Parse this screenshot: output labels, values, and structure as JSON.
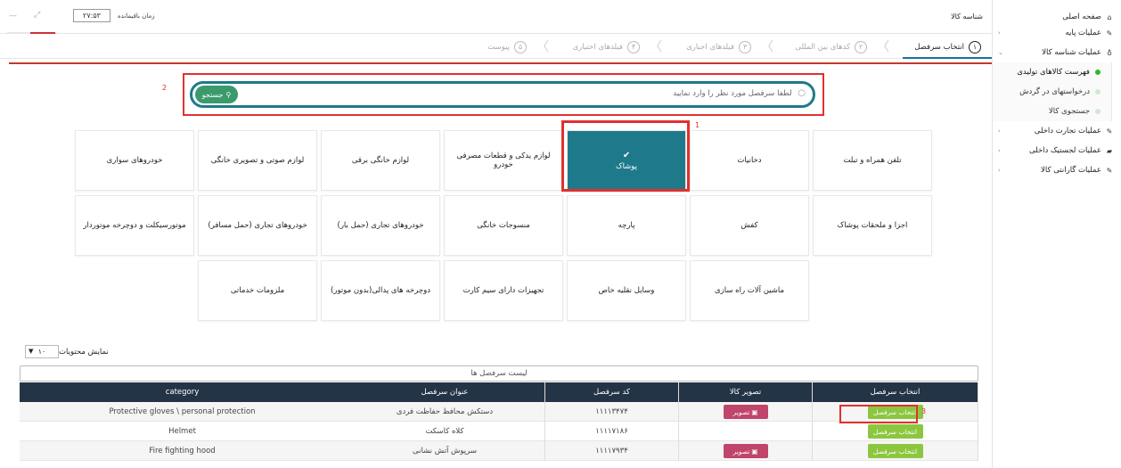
{
  "sidebar": {
    "home": "صفحه اصلی",
    "items": [
      {
        "label": "عملیات پایه",
        "icon": "edit-icon"
      },
      {
        "label": "عملیات شناسه کالا",
        "icon": "bicycle-icon"
      }
    ],
    "subitems": [
      {
        "label": "فهرست کالاهای تولیدی",
        "active": true
      },
      {
        "label": "درخواستهای در گردش",
        "active": false
      },
      {
        "label": "جستجوی کالا",
        "active": false
      }
    ],
    "items2": [
      {
        "label": "عملیات تجارت داخلی",
        "icon": "edit-icon"
      },
      {
        "label": "عملیات لجستیک داخلی",
        "icon": "truck-icon"
      },
      {
        "label": "عملیات گارانتی کالا",
        "icon": "edit-icon"
      }
    ]
  },
  "topbar": {
    "title": "شناسه کالا",
    "time_label": "زمان باقیمانده",
    "time_value": "۲۷:۵۳"
  },
  "steps": [
    {
      "num": "۱",
      "label": "انتخاب سرفصل"
    },
    {
      "num": "۲",
      "label": "کدهای بین المللی"
    },
    {
      "num": "۳",
      "label": "فیلدهای اجباری"
    },
    {
      "num": "۴",
      "label": "فیلدهای اختیاری"
    },
    {
      "num": "۵",
      "label": "پیوست"
    }
  ],
  "search": {
    "placeholder": "لطفا سرفصل مورد نظر را وارد نمایید",
    "button": "جستجو"
  },
  "annotations": {
    "search": "2",
    "tile": "1",
    "row": "3"
  },
  "categories": {
    "row1": [
      "تلفن همراه و تبلت",
      "دخانیات",
      "پوشاک",
      "لوازم یدکی و قطعات مصرفی خودرو",
      "لوازم خانگی برقی",
      "لوازم صوتی و تصویری خانگی",
      "خودروهای سواری"
    ],
    "row2": [
      "اجزا و ملحقات پوشاک",
      "کفش",
      "پارچه",
      "منسوجات خانگی",
      "خودروهای تجاری (حمل بار)",
      "خودروهای تجاری (حمل مسافر)",
      "موتورسیکلت و دوچرخه موتوردار"
    ],
    "row3": [
      "ماشین آلات راه سازی",
      "وسایل نقلیه خاص",
      "تجهیزات دارای سیم کارت",
      "دوچرخه های پدالی(بدون موتور)",
      "ملزومات خدماتی"
    ],
    "selected": "پوشاک"
  },
  "list": {
    "show_label": "نمایش محتویات",
    "show_value": "۱۰",
    "title": "لیست سرفصل ها",
    "headers": {
      "select": "انتخاب سرفصل",
      "image": "تصویر کالا",
      "code": "کد سرفصل",
      "name": "عنوان سرفصل",
      "category": "category"
    },
    "rows": [
      {
        "select": "انتخاب سرفصل",
        "image": "تصویر",
        "code": "۱۱۱۱۳۴۷۴",
        "name": "دستکش محافظ حفاظت فردی",
        "category": "Protective gloves \\ personal protection"
      },
      {
        "select": "انتخاب سرفصل",
        "image": "",
        "code": "۱۱۱۱۷۱۸۶",
        "name": "کلاه کاسکت",
        "category": "Helmet"
      },
      {
        "select": "انتخاب سرفصل",
        "image": "تصویر",
        "code": "۱۱۱۱۷۹۳۴",
        "name": "سرپوش آتش نشانی",
        "category": "Fire fighting hood"
      }
    ]
  },
  "colors": {
    "accent": "#1e7a8a",
    "header": "#243447",
    "green": "#8cc63f",
    "pink": "#c0456b",
    "red": "#e0312f"
  }
}
